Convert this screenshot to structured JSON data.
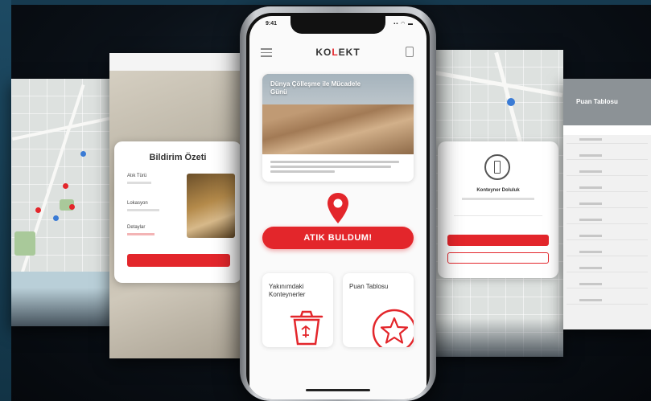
{
  "app": {
    "logo_text_before": "KO",
    "logo_accent": "L",
    "logo_text_after": "EKT",
    "status_time": "9:41",
    "status_icons": "▪▪ ◠ ▬"
  },
  "hero": {
    "title": "Dünya Çölleşme ile Mücadele Günü",
    "carousel_dots": 4,
    "active_dot": 2
  },
  "cta": {
    "label": "ATIK BULDUM!"
  },
  "tiles": [
    {
      "label": "Yakınımdaki Konteynerler",
      "icon": "trash-bin-icon"
    },
    {
      "label": "Puan Tablosu",
      "icon": "star-icon"
    }
  ],
  "left_screen": {
    "card_title": "Bildirim Özeti",
    "fields": [
      {
        "label": "Atık Türü"
      },
      {
        "label": "Lokasyon"
      },
      {
        "label": "Detaylar"
      }
    ]
  },
  "right_screen": {
    "card_title": "Konteyner Doluluk"
  },
  "table_screen": {
    "title": "Puan Tablosu"
  },
  "colors": {
    "accent": "#e3262b",
    "background": "#0b1118"
  }
}
